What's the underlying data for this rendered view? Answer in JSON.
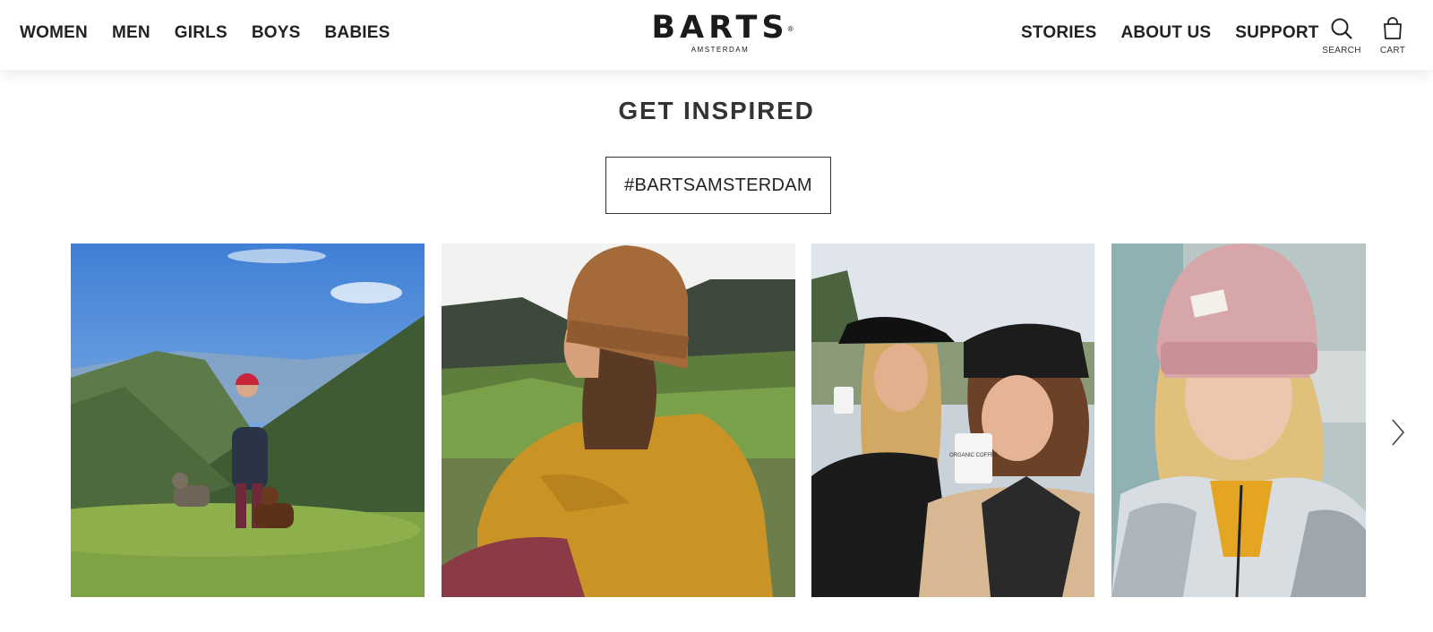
{
  "nav": {
    "left": [
      "WOMEN",
      "MEN",
      "GIRLS",
      "BOYS",
      "BABIES"
    ],
    "right": [
      "STORIES",
      "ABOUT US",
      "SUPPORT"
    ]
  },
  "logo": {
    "wordmark": "BARTS",
    "registered": "®",
    "sub": "AMSTERDAM"
  },
  "icons": {
    "search": {
      "label": "SEARCH",
      "icon": "search-icon"
    },
    "cart": {
      "label": "CART",
      "icon": "cart-icon"
    }
  },
  "section": {
    "title": "GET INSPIRED",
    "hashtag": "#BARTSAMSTERDAM"
  },
  "gallery": {
    "photo_cup_text": "ORGANIC COFFEE",
    "next_icon": "chevron-right-icon"
  },
  "colors": {
    "text": "#222222",
    "border": "#333333",
    "background": "#ffffff"
  }
}
